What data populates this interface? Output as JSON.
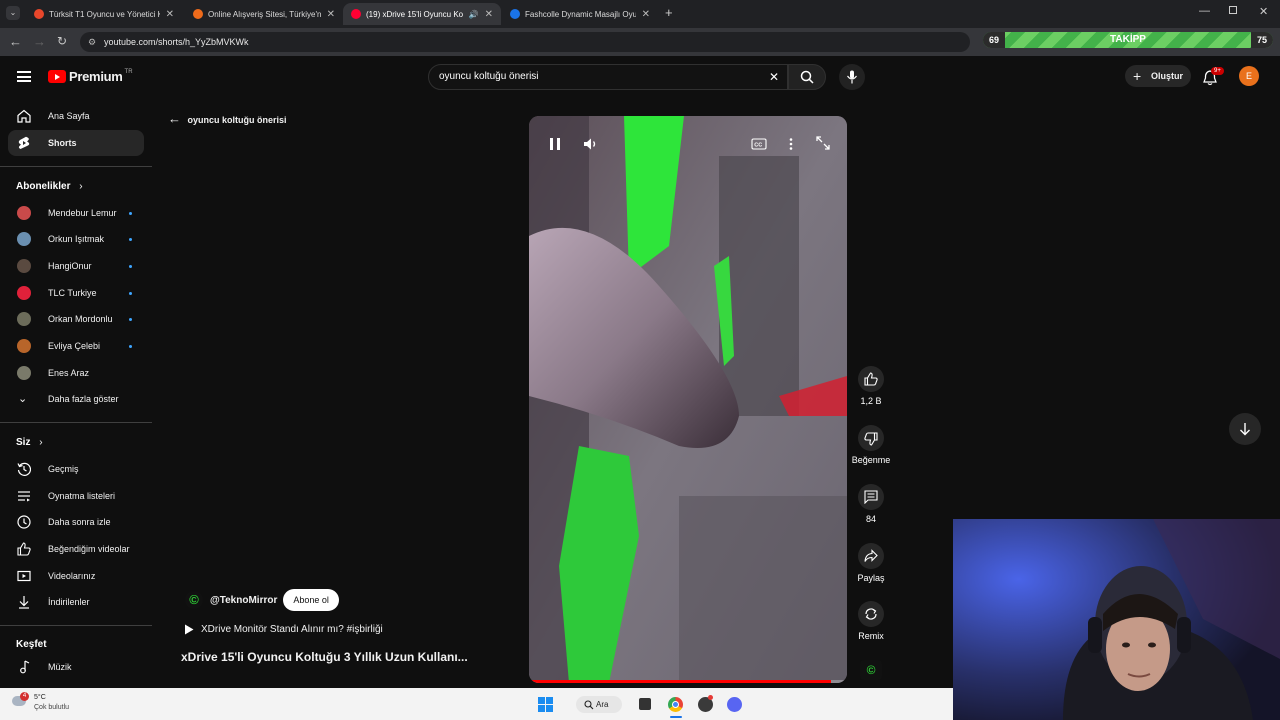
{
  "browser": {
    "tabs": [
      {
        "title": "Türksit T1 Oyuncu ve Yönetici Ko",
        "favicon_color": "#e8472b"
      },
      {
        "title": "Online Alışveriş Sitesi, Türkiye'n",
        "favicon_color": "#ef6b1b"
      },
      {
        "title": "(19) xDrive 15'li Oyuncu Ko",
        "favicon_color": "#ff0033"
      },
      {
        "title": "Fashcolle Dynamic Masajlı Oyu",
        "favicon_color": "#1a73e8"
      }
    ],
    "url": "youtube.com/shorts/h_YyZbMVKWk",
    "progress_widget": {
      "left_value": "69",
      "label": "TAKİPP",
      "right_value": "75"
    }
  },
  "header": {
    "logo_text": "Premium",
    "logo_superscript": "TR",
    "search_value": "oyuncu koltuğu önerisi",
    "create_label": "Oluştur",
    "notification_badge": "9+",
    "avatar_letter": "E"
  },
  "sidebar": {
    "main": [
      {
        "label": "Ana Sayfa",
        "icon": "home-icon"
      },
      {
        "label": "Shorts",
        "icon": "shorts-icon",
        "selected": true
      }
    ],
    "subscriptions_title": "Abonelikler",
    "subscriptions": [
      {
        "label": "Mendebur Lemur",
        "color": "#c94a4a"
      },
      {
        "label": "Orkun Işıtmak",
        "color": "#6a8fb0"
      },
      {
        "label": "HangiOnur",
        "color": "#5a4a40"
      },
      {
        "label": "TLC Turkiye",
        "color": "#e0213a"
      },
      {
        "label": "Orkan Mordonlu",
        "color": "#6c6c5a"
      },
      {
        "label": "Evliya Çelebi",
        "color": "#b8652a"
      },
      {
        "label": "Enes Araz",
        "color": "#7a7a6a"
      }
    ],
    "show_more": "Daha fazla göster",
    "you_title": "Siz",
    "you_items": [
      {
        "label": "Geçmiş",
        "icon": "history-icon"
      },
      {
        "label": "Oynatma listeleri",
        "icon": "playlist-icon"
      },
      {
        "label": "Daha sonra izle",
        "icon": "watch-later-icon"
      },
      {
        "label": "Beğendiğim videolar",
        "icon": "like-icon"
      },
      {
        "label": "Videolarınız",
        "icon": "video-icon"
      },
      {
        "label": "İndirilenler",
        "icon": "download-icon"
      }
    ],
    "explore_title": "Keşfet",
    "explore_items": [
      {
        "label": "Müzik",
        "icon": "music-icon"
      }
    ]
  },
  "shorts": {
    "back_label": "oyuncu koltuğu önerisi",
    "channel": "@TeknoMirror",
    "subscribe_label": "Abone ol",
    "link_text": "XDrive Monitör Standı Alınır mı? #işbirliği",
    "title": "xDrive 15'li Oyuncu Koltuğu 3 Yıllık Uzun Kullanı...",
    "actions": [
      {
        "label": "1,2 B",
        "icon": "thumbs-up-icon"
      },
      {
        "label": "Beğenme",
        "icon": "thumbs-down-icon"
      },
      {
        "label": "84",
        "icon": "comment-icon"
      },
      {
        "label": "Paylaş",
        "icon": "share-icon"
      },
      {
        "label": "Remix",
        "icon": "remix-icon"
      }
    ],
    "progress": 0.95
  },
  "taskbar": {
    "weather_temp": "5°C",
    "weather_desc": "Çok bulutlu",
    "weather_badge": "4",
    "search_label": "Ara"
  }
}
